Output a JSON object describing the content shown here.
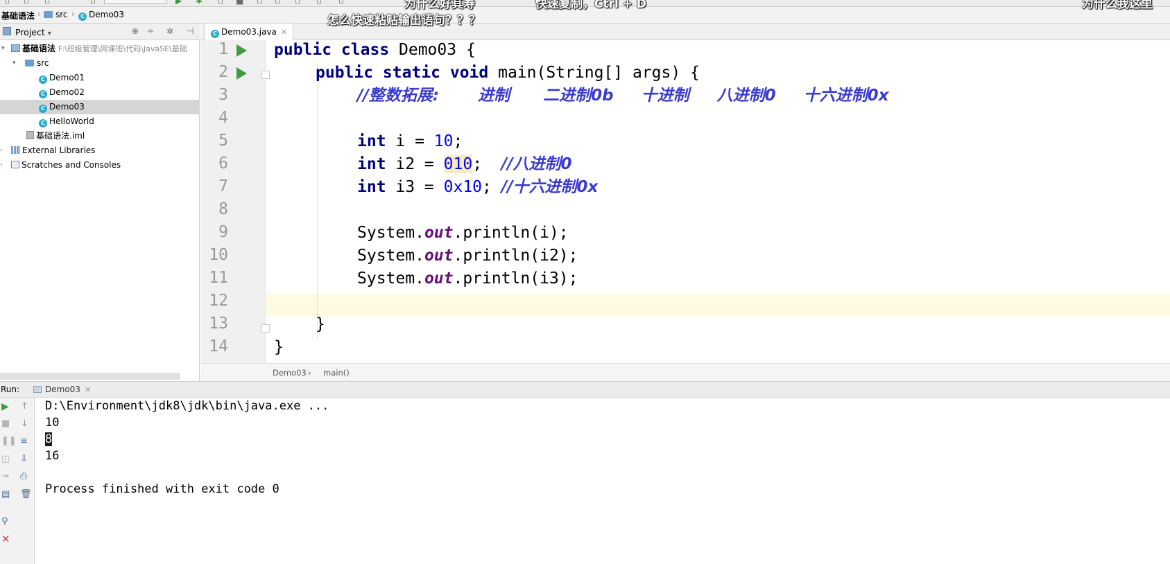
{
  "overlays": {
    "top_a": "为什么好其寿",
    "top_b": "快速复制，Ctrl + D",
    "top_c": "为什么我这里",
    "question": "怎么快速粘贴输出语句？？？"
  },
  "navbar": {
    "project": "基础语法",
    "folder": "src",
    "file": "Demo03"
  },
  "project_panel": {
    "title": "Project",
    "dropdown_glyph": "▾",
    "tree": [
      {
        "label": "基础语法",
        "path": "F:\\班级管理\\网课班\\代码\\JavaSE\\基础",
        "expanded": true
      },
      {
        "label": "src",
        "expanded": true
      },
      {
        "label": "Demo01"
      },
      {
        "label": "Demo02"
      },
      {
        "label": "Demo03",
        "selected": true
      },
      {
        "label": "HelloWorld"
      },
      {
        "label": "基础语法.iml"
      },
      {
        "label": "External Libraries",
        "expanded": false
      },
      {
        "label": "Scratches and Consoles",
        "expanded": false
      }
    ]
  },
  "editor": {
    "tab_label": "Demo03.java",
    "line_numbers": [
      "1",
      "2",
      "3",
      "4",
      "5",
      "6",
      "7",
      "8",
      "9",
      "10",
      "11",
      "12",
      "13",
      "14"
    ],
    "code": {
      "l1_kw": "public class",
      "l1_rest": " Demo03 {",
      "l2_kw": "public static void",
      "l2_rest": " main(String[] args) {",
      "l3_comment": "//整数拓展:       进制      二进制0b     十进制     八进制0     十六进制0x",
      "l5_kw": "int",
      "l5_a": " i = ",
      "l5_num": "10",
      "l5_b": ";",
      "l6_kw": "int",
      "l6_a": " i2 = ",
      "l6_num": "010",
      "l6_b": ";  ",
      "l6_comment": "//八进制0",
      "l7_kw": "int",
      "l7_a": " i3 = ",
      "l7_num": "0x10",
      "l7_b": "; ",
      "l7_comment": "//十六进制0x",
      "sys": "System.",
      "out": "out",
      "p9": ".println(i);",
      "p10": ".println(i2);",
      "p11": ".println(i3);",
      "l13": "}",
      "l14": "}"
    },
    "crumbs": {
      "cls": "Demo03",
      "sep": "›",
      "method": "main()"
    }
  },
  "run": {
    "label": "Run:",
    "tab": "Demo03",
    "console": {
      "cmd": "D:\\Environment\\jdk8\\jdk\\bin\\java.exe ...",
      "out1": "10",
      "out2": "8",
      "out3": "16",
      "finished": "Process finished with exit code 0"
    }
  },
  "colors": {
    "keyword": "#000080",
    "number": "#0000ff",
    "comment": "#3b3bd0",
    "static_field": "#660e7a",
    "run_green": "#3f9b3f"
  }
}
